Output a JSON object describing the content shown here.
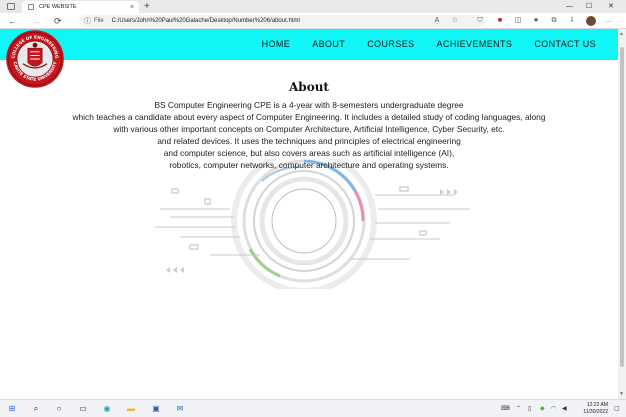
{
  "browser": {
    "tab_title": "CPE WEBSITE",
    "tab_close": "×",
    "new_tab": "+",
    "file_label": "File",
    "url": "C:/Users/John%20Paul%20Galache/Desktop/Number%206/about.html",
    "back": "←",
    "forward": "→",
    "reload": "⟳",
    "minimize": "—",
    "maximize": "☐",
    "close": "✕"
  },
  "nav": {
    "items": [
      "HOME",
      "ABOUT",
      "COURSES",
      "ACHIEVEMENTS",
      "CONTACT US"
    ]
  },
  "logo": {
    "top_text": "COLLEGE OF ENGINEERING",
    "bottom_text": "CAVITE STATE UNIVERSITY",
    "colors": {
      "outer": "#c8141e",
      "inner": "#e9e9e9",
      "accent": "#7a0d12"
    }
  },
  "about": {
    "title": "About",
    "lines": [
      "BS Computer Engineering CPE is a 4-year with 8-semesters undergraduate degree",
      "which teaches a candidate about every aspect of Computer Engineering. It includes a detailed study of coding languages, along",
      "with various other important concepts on Computer Architecture, Artificial Intelligence, Cyber Security, etc.",
      "and related devices. It uses the techniques and principles of electrical engineering",
      "and computer science, but also covers areas such as artificial intelligence (AI),",
      "robotics, computer networks, computer architecture and operating systems."
    ]
  },
  "taskbar": {
    "time": "12:22 AM",
    "date": "11/30/2022",
    "icons": [
      "windows-icon",
      "search-icon",
      "task-view-icon",
      "widgets-icon",
      "edge-icon",
      "file-explorer-icon",
      "store-icon",
      "mail-icon"
    ]
  },
  "colors": {
    "header_bg": "#10f5f5",
    "logo_red": "#c8141e"
  }
}
